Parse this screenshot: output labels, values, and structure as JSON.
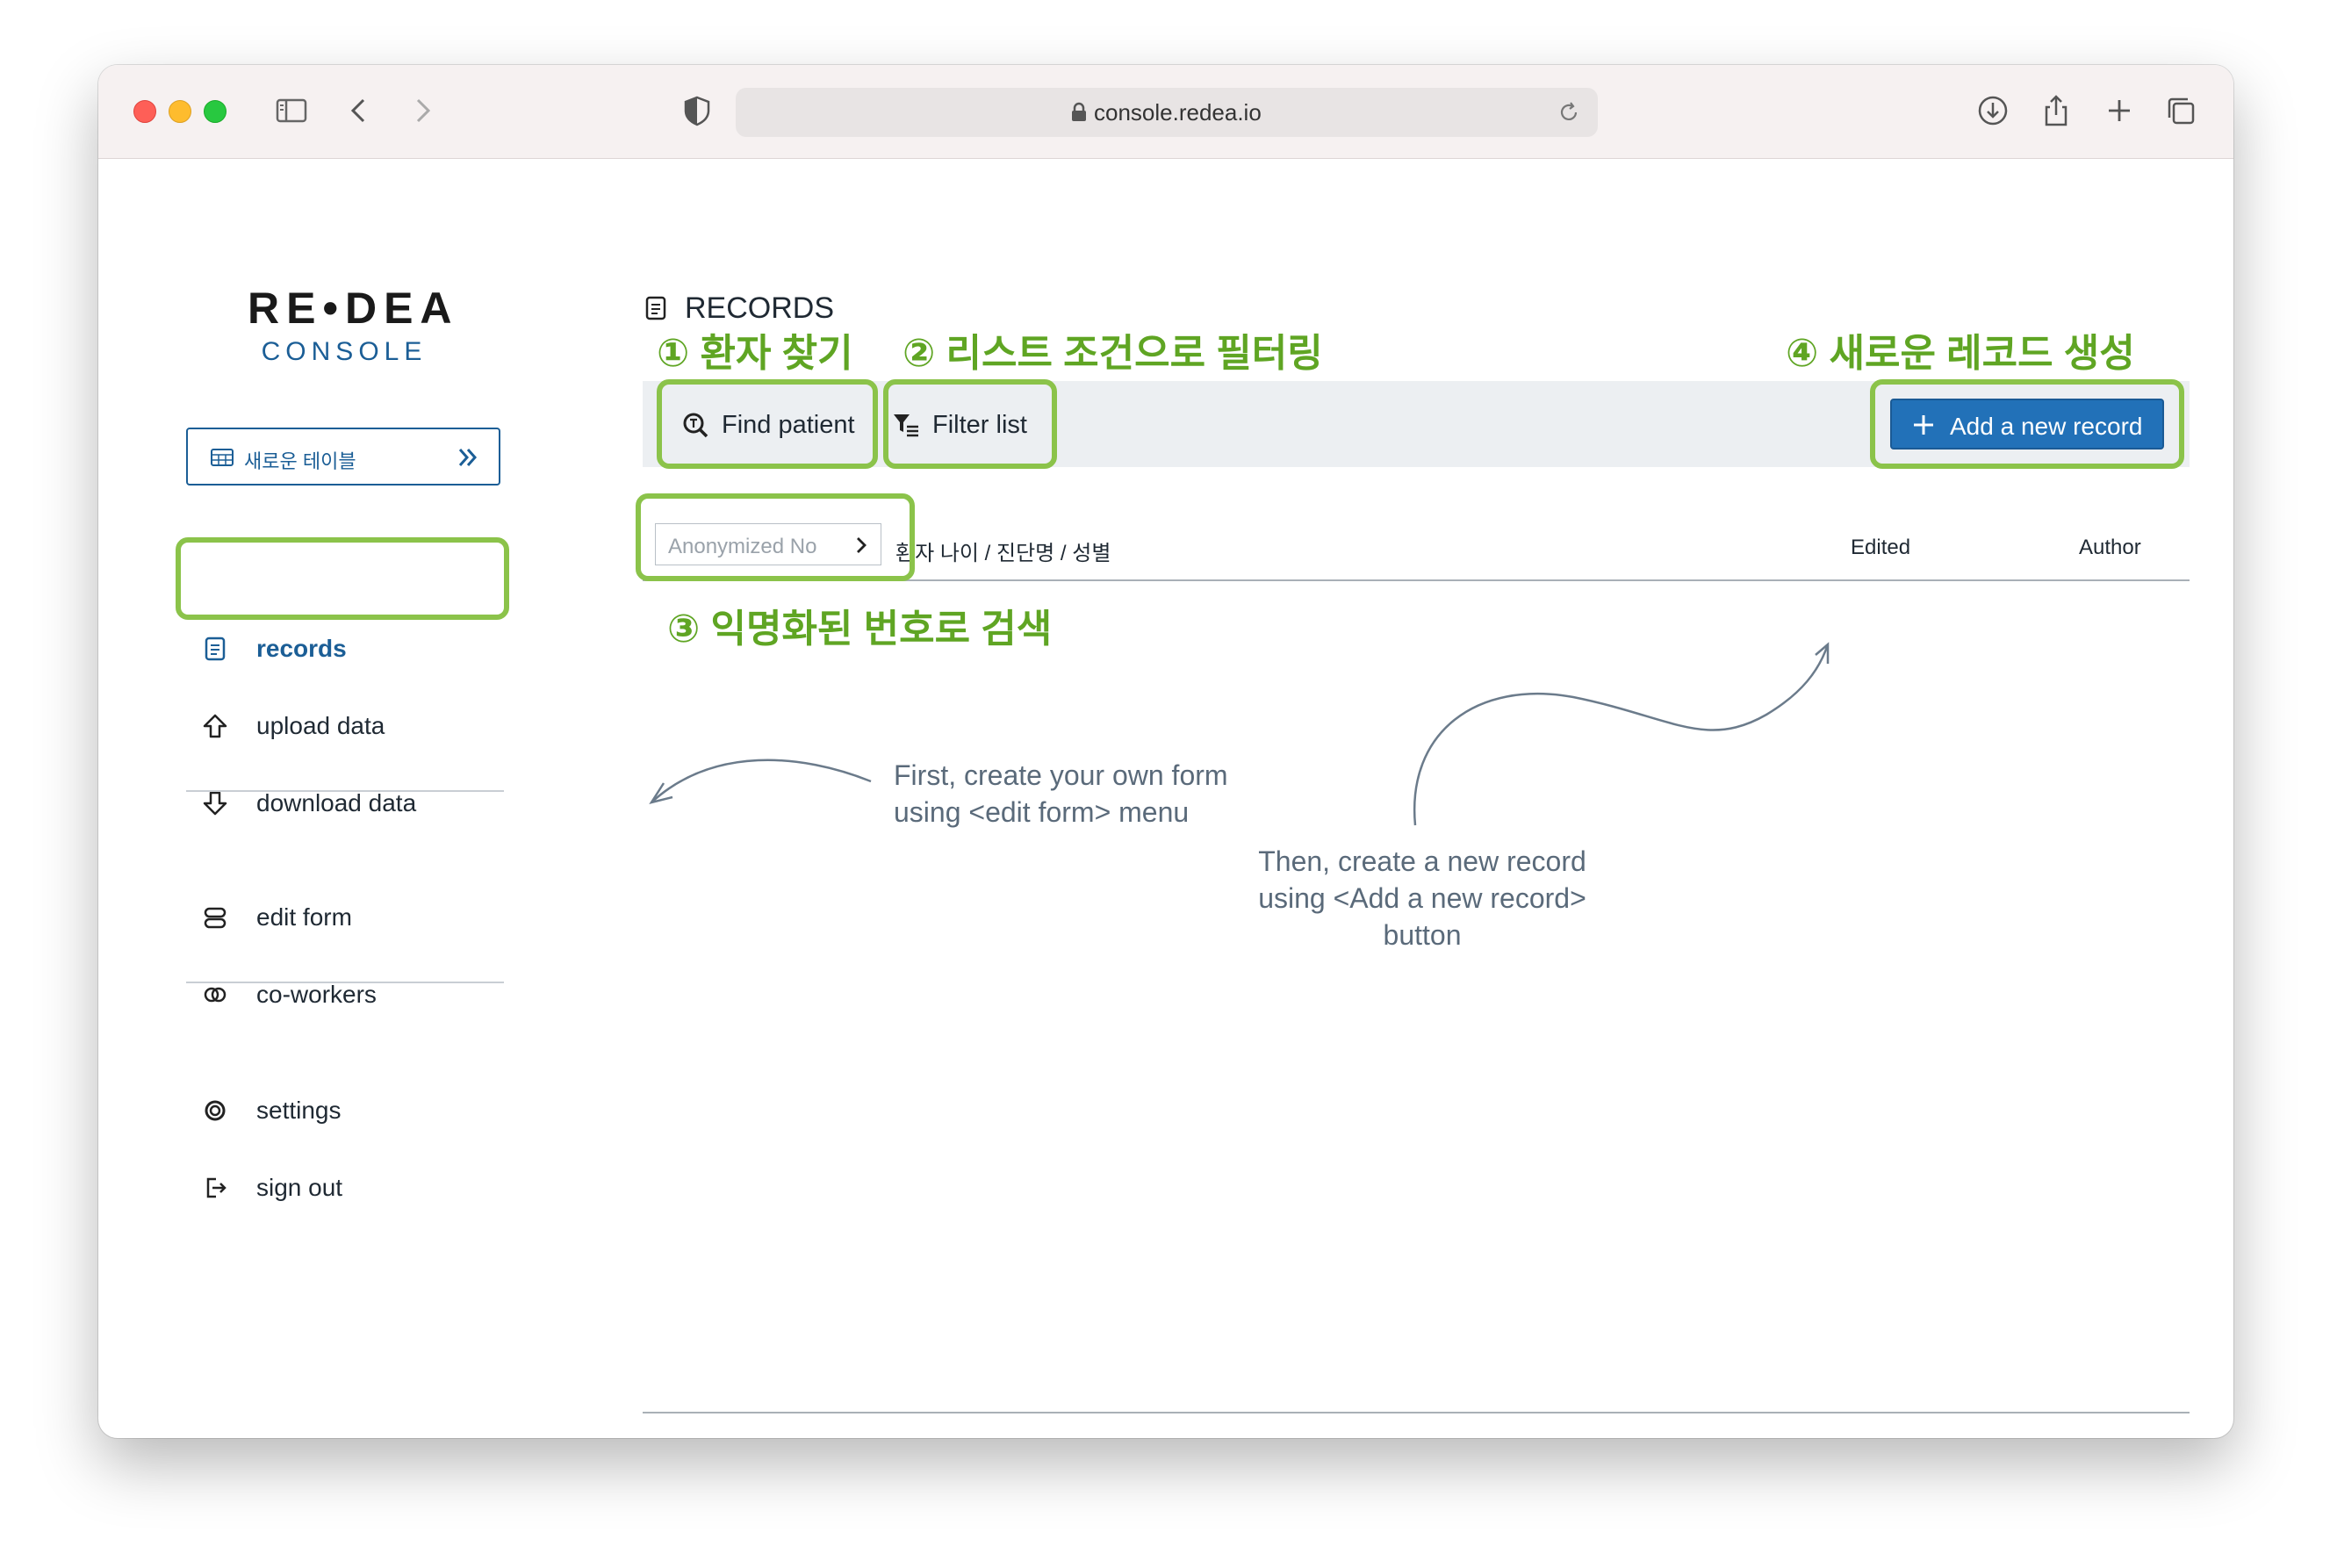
{
  "browser": {
    "url": "console.redea.io"
  },
  "logo": {
    "main": "RE•DEA",
    "sub": "CONSOLE"
  },
  "sidebar": {
    "new_table_label": "새로운 테이블",
    "items": [
      {
        "label": "records",
        "icon": "document-icon",
        "active": true
      },
      {
        "label": "upload data",
        "icon": "upload-arrow-icon"
      },
      {
        "label": "download data",
        "icon": "download-arrow-icon"
      },
      {
        "label": "edit form",
        "icon": "form-stack-icon"
      },
      {
        "label": "co-workers",
        "icon": "coworkers-icon"
      },
      {
        "label": "settings",
        "icon": "settings-ring-icon"
      },
      {
        "label": "sign out",
        "icon": "sign-out-icon"
      }
    ]
  },
  "main": {
    "title": "RECORDS",
    "toolbar": {
      "find_patient": "Find patient",
      "filter_list": "Filter list",
      "add_record": "Add a new record"
    },
    "table": {
      "anon_placeholder": "Anonymized No",
      "columns": [
        "환자 나이 / 진단명 / 성별",
        "Edited",
        "Author"
      ]
    }
  },
  "annotations": {
    "label_1": "① 환자 찾기",
    "label_2": "② 리스트 조건으로 필터링",
    "label_3": "③ 익명화된 번호로 검색",
    "label_4": "④ 새로운 레코드 생성",
    "hint_1_line1": "First, create your own form",
    "hint_1_line2": "using <edit form> menu",
    "hint_2_line1": "Then, create a new record",
    "hint_2_line2": "using <Add a new record>",
    "hint_2_line3": "button"
  },
  "colors": {
    "accent": "#1b5e96",
    "button": "#2271b8",
    "highlight": "#8bc34a",
    "annotation_text": "#5fa523"
  }
}
